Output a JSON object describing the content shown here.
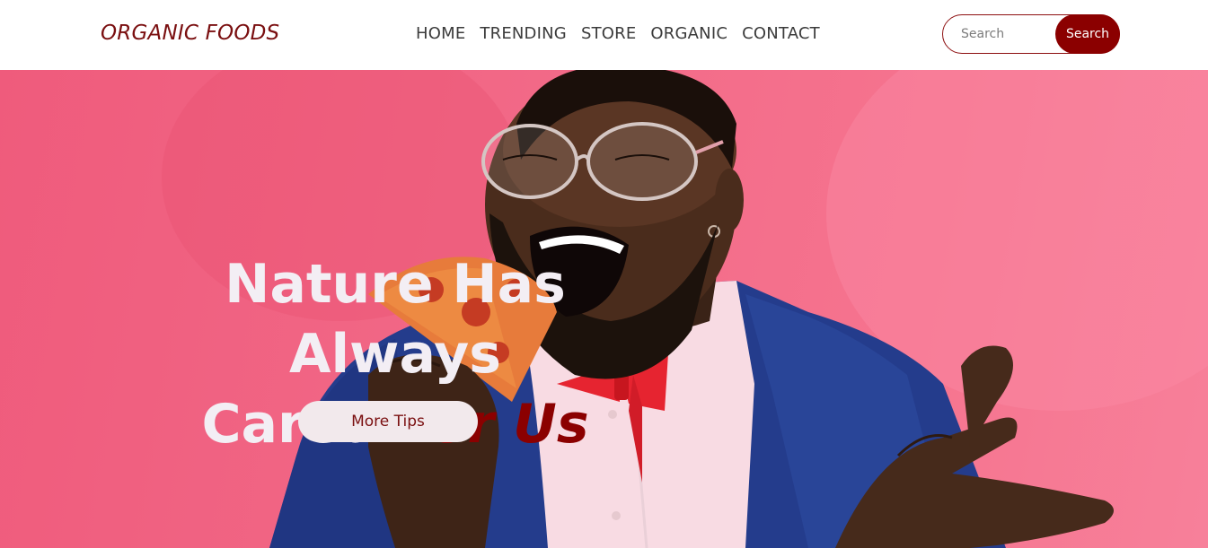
{
  "navbar": {
    "brand": "ORGANIC FOODS",
    "links": [
      "HOME",
      "TRENDING",
      "STORE",
      "ORGANIC",
      "CONTACT"
    ],
    "search_placeholder": "Search",
    "search_button": "Search"
  },
  "hero": {
    "title_line1": "Nature Has Always",
    "title_line2_plain": "Cared",
    "title_line2_accent": "For Us",
    "cta_label": "More Tips"
  },
  "colors": {
    "brand": "#7a0f10",
    "accent": "#8b0000",
    "hero_bg": "#f26a88",
    "headline": "#f3eef4"
  }
}
